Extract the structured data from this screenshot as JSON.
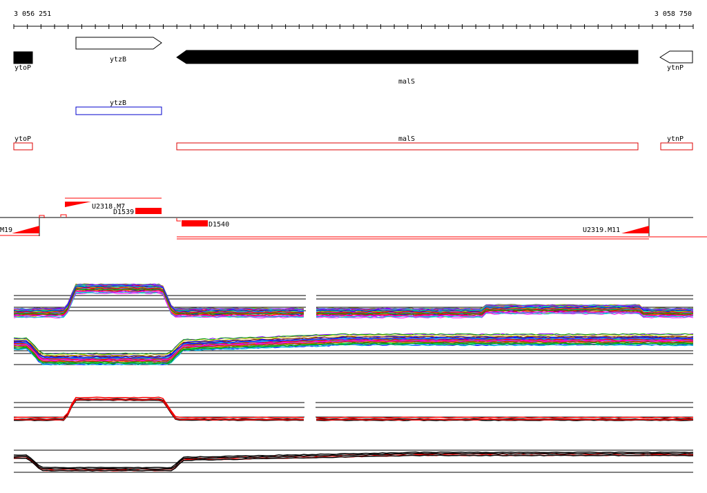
{
  "ruler": {
    "start_label": "3 056 251",
    "end_label": "3 058 750"
  },
  "genes": [
    {
      "name": "ytoP",
      "strand": "-",
      "fill": "#000000"
    },
    {
      "name": "ytzB",
      "strand": "+",
      "fill": "#ffffff"
    },
    {
      "name": "malS",
      "strand": "-",
      "fill": "#000000"
    },
    {
      "name": "ytnP",
      "strand": "-",
      "fill": "#ffffff"
    }
  ],
  "annotation_blue": [
    {
      "name": "ytzB",
      "color": "#0000cc"
    }
  ],
  "annotation_red": [
    {
      "name": "ytoP",
      "color": "#dd0000"
    },
    {
      "name": "malS",
      "color": "#dd0000"
    },
    {
      "name": "ytnP",
      "color": "#dd0000"
    }
  ],
  "features": [
    {
      "name": "M19",
      "kind": "promoter"
    },
    {
      "name": "U2318.M7",
      "kind": "promoter"
    },
    {
      "name": "D1539",
      "kind": "block"
    },
    {
      "name": "D1540",
      "kind": "block"
    },
    {
      "name": "U2319.M11",
      "kind": "promoter"
    }
  ],
  "colors": {
    "feature_red": "#ff0000",
    "axis": "#000000"
  }
}
